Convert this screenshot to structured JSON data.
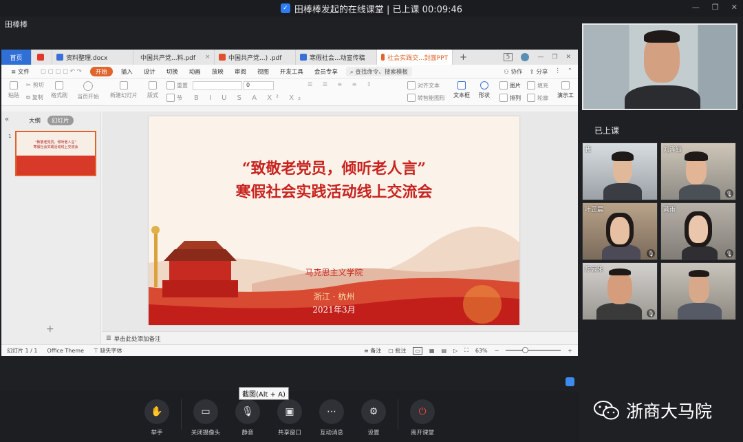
{
  "titlebar": {
    "title": "田棒棒发起的在线课堂 | 已上课 00:09:46"
  },
  "host": {
    "name": "田棒棒"
  },
  "wps": {
    "tabs": [
      {
        "label": "首页"
      },
      {
        "label": "资料整理.docx"
      },
      {
        "label": "中国共产党...料.pdf"
      },
      {
        "label": "中国共产党...) .pdf"
      },
      {
        "label": "寒假社会...动宣传稿"
      },
      {
        "label": "社会实践交...封面PPT"
      }
    ],
    "tab_count_badge": "5",
    "menu": {
      "file": "文件",
      "start": "开始",
      "items": [
        "插入",
        "设计",
        "切换",
        "动画",
        "放映",
        "审阅",
        "视图",
        "开发工具",
        "会员专享"
      ],
      "search": "查找命令、搜索模板",
      "collab": "协作",
      "share": "分享"
    },
    "ribbon": {
      "paste": "粘贴",
      "cut": "剪切",
      "copy": "复制",
      "format_painter": "格式刷",
      "from_current": "当页开始",
      "new_slide": "新建幻灯片",
      "layout": "版式",
      "reset": "重置",
      "section": "节",
      "font_size": "0",
      "text_box": "文本框",
      "shape": "形状",
      "picture": "图片",
      "arrange": "排列",
      "fill": "填充",
      "outline": "轮廓",
      "align_text": "对齐文本",
      "smart_art": "转智能图形",
      "presenter": "演示工"
    },
    "leftpane": {
      "outline": "大纲",
      "slides": "幻灯片",
      "slide_number": "1"
    },
    "slide": {
      "title_line1": "“致敬老党员，倾听老人言”",
      "title_line2": "寒假社会实践活动线上交流会",
      "org": "马克思主义学院",
      "location": "浙江 · 杭州",
      "date": "2021年3月"
    },
    "notes_placeholder": "单击此处添加备注",
    "status": {
      "slide_index": "幻灯片 1 / 1",
      "theme": "Office Theme",
      "missing_font": "缺失字体",
      "notes": "备注",
      "comment": "批注",
      "zoom": "63%",
      "zoom_fraction": 0.35
    }
  },
  "panel": {
    "in_class_label": "已上课",
    "participants": [
      {
        "name": "我",
        "muted": false
      },
      {
        "name": "刘泽钰",
        "muted": true
      },
      {
        "name": "叶芷晨",
        "muted": true
      },
      {
        "name": "龚雨",
        "muted": true
      },
      {
        "name": "陈云来",
        "muted": true
      },
      {
        "name": "",
        "muted": false
      }
    ]
  },
  "tooltip": "截图(Alt + A)",
  "toolbar": {
    "raise_hand": "举手",
    "camera_off": "关闭摄像头",
    "mute": "静音",
    "share_window": "共享窗口",
    "interact_msg": "互动消息",
    "settings": "设置",
    "leave": "离开课堂"
  },
  "watermark": "浙商大马院",
  "colors": {
    "accent_orange": "#e0642b",
    "slide_red": "#c8231f",
    "home_blue": "#2f6fd6",
    "leave_red": "#e2483d"
  }
}
